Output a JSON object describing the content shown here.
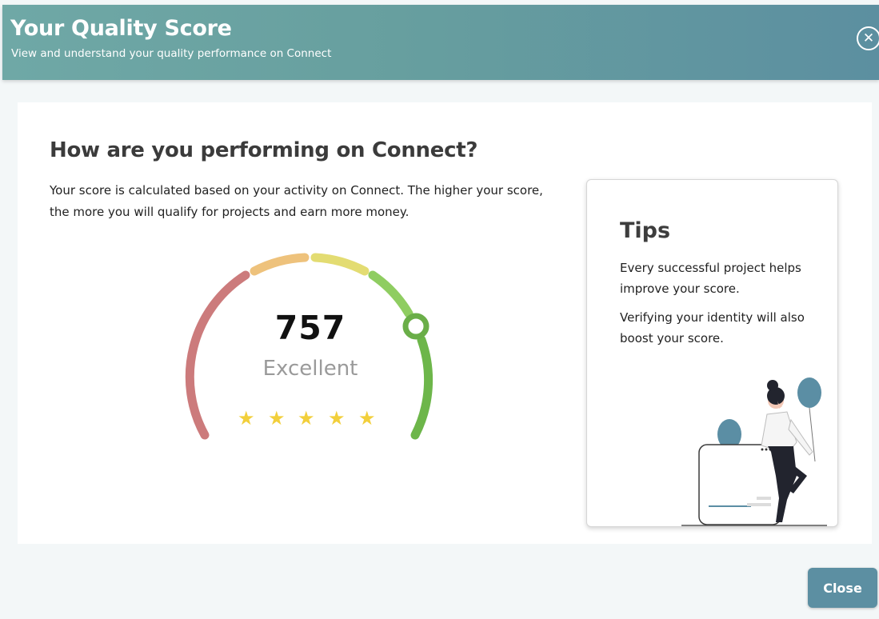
{
  "header": {
    "title": "Your Quality Score",
    "subtitle": "View and understand your quality performance on Connect",
    "close_icon": "close-circle-icon"
  },
  "main": {
    "heading": "How are you performing on Connect?",
    "description": "Your score is calculated based on your activity on Connect. The higher your score, the more you will qualify for projects and earn more money."
  },
  "score": {
    "value": "757",
    "label": "Excellent",
    "stars": 5,
    "gauge_colors": [
      "#cc7b7c",
      "#eec27c",
      "#e3dc72",
      "#8fcd61",
      "#6db64a"
    ],
    "marker_color": "#6aae48"
  },
  "tips": {
    "title": "Tips",
    "line1": "Every successful project helps improve your score.",
    "line2": "Verifying your identity will also boost your score."
  },
  "footer": {
    "close_label": "Close"
  }
}
